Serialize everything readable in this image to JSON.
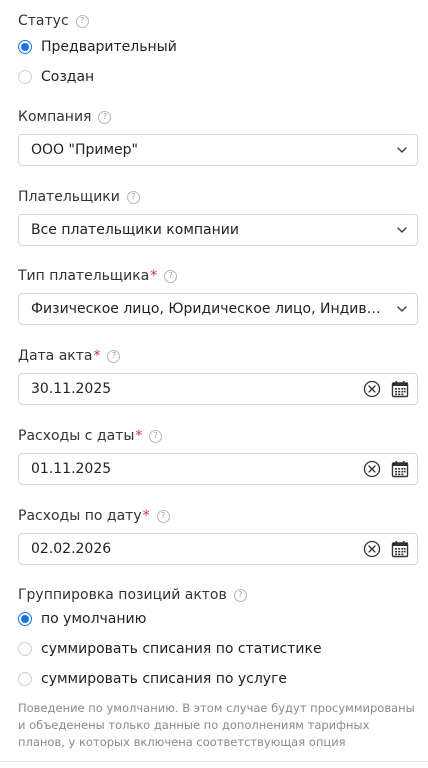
{
  "status": {
    "label": "Статус",
    "help": "?",
    "options": [
      {
        "label": "Предварительный",
        "selected": true
      },
      {
        "label": "Создан",
        "selected": false
      }
    ]
  },
  "company": {
    "label": "Компания",
    "help": "?",
    "value": "ООО \"Пример\""
  },
  "payers": {
    "label": "Плательщики",
    "help": "?",
    "value": "Все плательщики компании"
  },
  "payer_type": {
    "label": "Тип плательщика",
    "required_mark": "*",
    "help": "?",
    "value": "Физическое лицо, Юридическое лицо, Индивидуальный предприниматель"
  },
  "act_date": {
    "label": "Дата акта",
    "required_mark": "*",
    "help": "?",
    "value": "30.11.2025"
  },
  "expenses_from": {
    "label": "Расходы с даты",
    "required_mark": "*",
    "help": "?",
    "value": "01.11.2025"
  },
  "expenses_to": {
    "label": "Расходы по дату",
    "required_mark": "*",
    "help": "?",
    "value": "02.02.2026"
  },
  "grouping": {
    "label": "Группировка позиций актов",
    "help": "?",
    "options": [
      {
        "label": "по умолчанию",
        "selected": true
      },
      {
        "label": "суммировать списания по статистике",
        "selected": false
      },
      {
        "label": "суммировать списания по услуге",
        "selected": false
      }
    ],
    "hint": "Поведение по умолчанию. В этом случае будут просуммированы и объеденены только данные по дополнениям тарифных планов, у которых включена соответствующая опция"
  },
  "colors": {
    "accent": "#1a73e8",
    "required": "#e02b3c",
    "border": "#d6d6d6"
  },
  "icons": [
    "help-icon",
    "chevron-down-icon",
    "clear-icon",
    "calendar-icon"
  ]
}
